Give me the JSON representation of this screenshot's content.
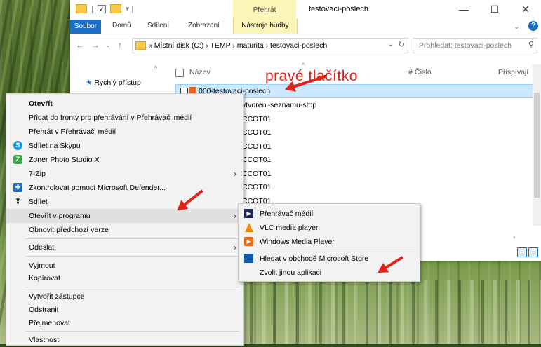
{
  "window": {
    "title": "testovaci-poslech",
    "context_tab": "Přehrát",
    "controls": {
      "minimize": "—",
      "maximize": "☐",
      "close": "✕"
    }
  },
  "ribbon": {
    "file_tab": "Soubor",
    "tabs": [
      "Domů",
      "Sdílení",
      "Zobrazení"
    ],
    "context_tab": "Nástroje hudby"
  },
  "address": {
    "path": "« Místní disk (C:)  ›  TEMP  ›  maturita  ›  testovaci-poslech",
    "search_placeholder": "Prohledat: testovaci-poslech"
  },
  "navpane": {
    "quick_access": "Rychlý přístup"
  },
  "columns": {
    "name": "Název",
    "number": "# Číslo",
    "contrib": "Přispívají"
  },
  "files": {
    "selected": "000-testovaci-poslech",
    "rows": [
      "ytvoreni-seznamu-stop",
      "CCOT01",
      "CCOT01",
      "CCOT01",
      "CCOT01",
      "CCOT01",
      "CCOT01",
      "CCOT01"
    ]
  },
  "annotation": "pravé tlačítko",
  "context_menu": {
    "open": "Otevřít",
    "add_queue": "Přidat do fronty pro přehrávání v Přehrávači médií",
    "play_media": "Přehrát v Přehrávači médií",
    "skype": "Sdílet na Skypu",
    "zoner": "Zoner Photo Studio X",
    "zip": "7-Zip",
    "defender": "Zkontrolovat pomocí Microsoft Defender...",
    "share": "Sdílet",
    "open_with": "Otevřít v programu",
    "restore": "Obnovit předchozí verze",
    "send_to": "Odeslat",
    "cut": "Vyjmout",
    "copy": "Kopírovat",
    "shortcut": "Vytvořit zástupce",
    "delete": "Odstranit",
    "rename": "Přejmenovat",
    "properties": "Vlastnosti"
  },
  "submenu": {
    "media_player": "Přehrávač médií",
    "vlc": "VLC media player",
    "wmp": "Windows Media Player",
    "store": "Hledat v obchodě Microsoft Store",
    "other": "Zvolit jinou aplikaci"
  }
}
